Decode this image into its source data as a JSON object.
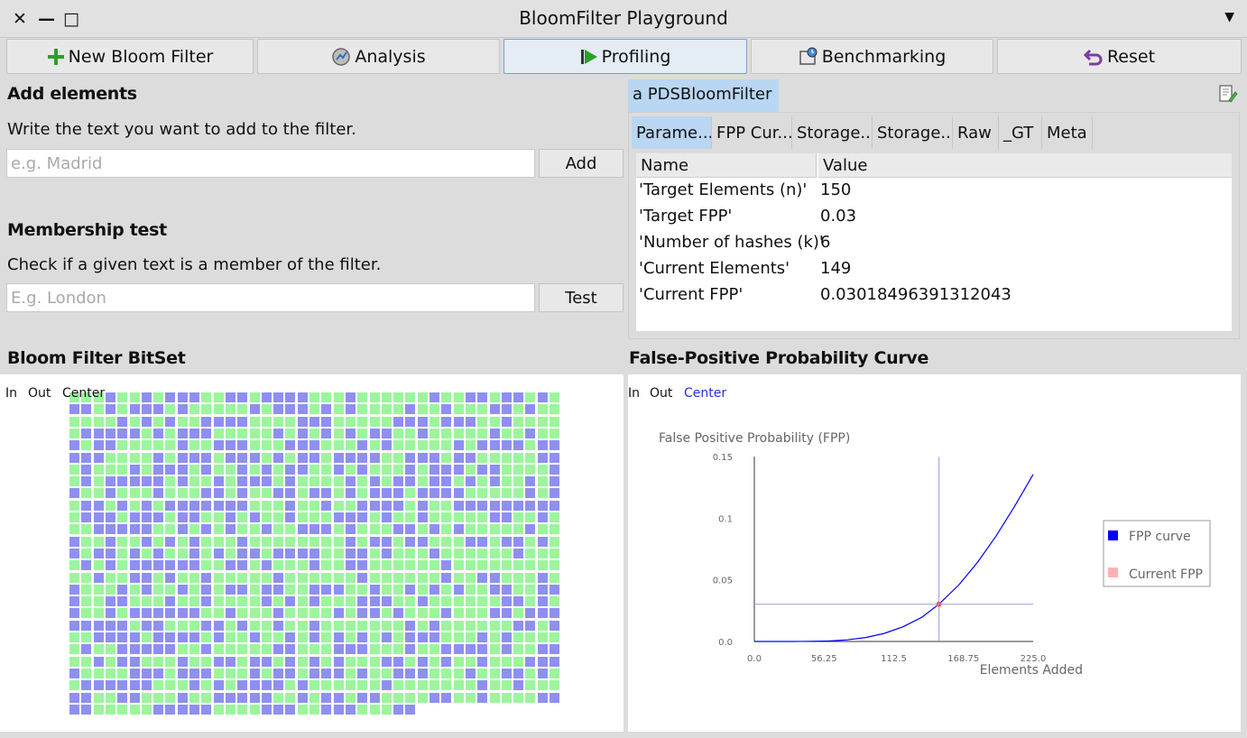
{
  "window": {
    "title": "BloomFilter Playground",
    "close_glyph": "✕",
    "minimize_glyph": "—",
    "maximize_glyph": "□",
    "menu_glyph": "▼"
  },
  "toolbar": {
    "new_label": "New Bloom Filter",
    "analysis_label": "Analysis",
    "profiling_label": "Profiling",
    "benchmarking_label": "Benchmarking",
    "reset_label": "Reset",
    "active": "profiling"
  },
  "add_section": {
    "title": "Add elements",
    "description": "Write the text you want to add to the filter.",
    "placeholder": "e.g. Madrid",
    "button_label": "Add"
  },
  "membership_section": {
    "title": "Membership test",
    "description": "Check if a given text is a member of the filter.",
    "placeholder": "E.g. London",
    "button_label": "Test"
  },
  "inspector": {
    "title": "a PDSBloomFilter",
    "tabs": [
      "Parame...",
      "FPP Cur...",
      "Storage...",
      "Storage...",
      "Raw",
      "_GT",
      "Meta"
    ],
    "active_tab": 0,
    "columns": [
      "Name",
      "Value"
    ],
    "rows": [
      {
        "name": "'Target Elements (n)'",
        "value": "150"
      },
      {
        "name": "'Target FPP'",
        "value": "0.03"
      },
      {
        "name": "'Number of hashes (k)'",
        "value": "6"
      },
      {
        "name": "'Current Elements'",
        "value": "149"
      },
      {
        "name": "'Current FPP'",
        "value": "0.03018496391312043"
      }
    ]
  },
  "bitset_panel": {
    "title": "Bloom Filter BitSet",
    "zoom_in": "In",
    "zoom_out": "Out",
    "center": "Center",
    "set_color": "#8f8ff0",
    "unset_color": "#9cf59c",
    "columns": 41,
    "rows": 27,
    "last_row_cells": 29
  },
  "fpp_panel": {
    "title": "False-Positive Probability Curve",
    "zoom_in": "In",
    "zoom_out": "Out",
    "center": "Center"
  },
  "chart_data": {
    "type": "line",
    "title": "False Positive Probability (FPP)",
    "xlabel": "Elements Added",
    "ylabel": "",
    "xlim": [
      0,
      225
    ],
    "ylim": [
      0,
      0.15
    ],
    "x_ticks": [
      "0.0",
      "56.25",
      "112.5",
      "168.75",
      "225.0"
    ],
    "y_ticks": [
      "0.0",
      "0.05",
      "0.1",
      "0.15"
    ],
    "series": [
      {
        "name": "FPP curve",
        "color": "#0000ff",
        "x": [
          0,
          15,
          30,
          45,
          60,
          75,
          90,
          105,
          120,
          135,
          149,
          165,
          180,
          195,
          210,
          225
        ],
        "y": [
          0.0,
          0.0,
          0.0,
          0.0001,
          0.0004,
          0.0013,
          0.0032,
          0.0066,
          0.0119,
          0.0195,
          0.0302,
          0.0458,
          0.064,
          0.0854,
          0.1095,
          0.1355
        ]
      }
    ],
    "current_fpp": {
      "name": "Current FPP",
      "x": 149,
      "y": 0.0302,
      "color": "#ffb3b3"
    },
    "legend": {
      "position": "right",
      "entries": [
        "FPP curve",
        "Current FPP"
      ]
    }
  }
}
